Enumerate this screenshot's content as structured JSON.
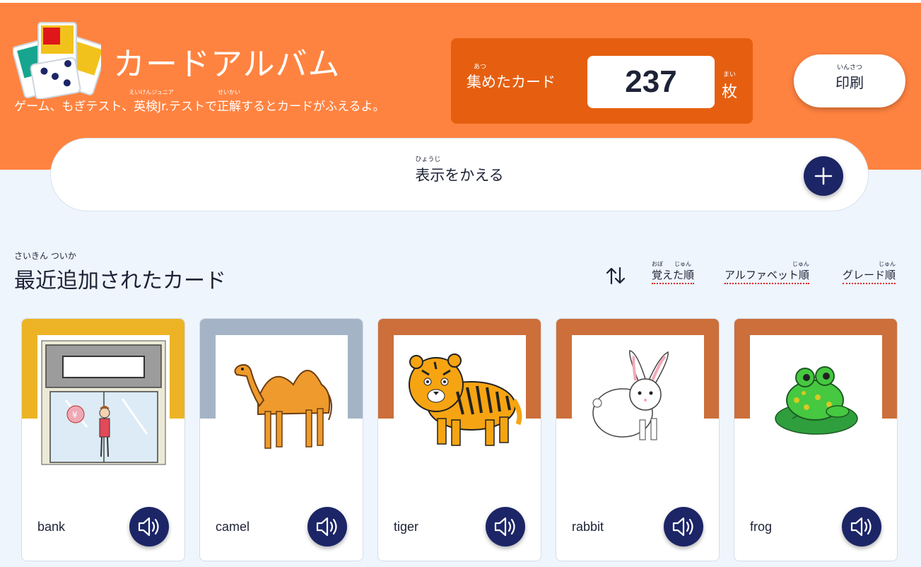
{
  "header": {
    "title": "カードアルバム",
    "subtitle_parts": [
      "ゲーム、もぎテスト、",
      "英検Jr.",
      "テストで",
      "正解",
      "するとカードがふえるよ。"
    ],
    "subtitle_ruby": {
      "eiken": "えいけんジュニア",
      "seikai": "せいかい"
    }
  },
  "counter": {
    "label": "集めたカード",
    "label_ruby": "あつ",
    "value": "237",
    "unit": "枚",
    "unit_ruby": "まい"
  },
  "print": {
    "label": "印刷",
    "ruby": "いんさつ"
  },
  "display_bar": {
    "label": "表示をかえる",
    "ruby": "ひょうじ"
  },
  "section": {
    "title": "最近追加されたカード",
    "ruby": "さいきん ついか"
  },
  "sort": {
    "options": [
      {
        "label": "覚えた順",
        "ruby": "おぼ　　じゅん"
      },
      {
        "label": "アルファベット順",
        "ruby": "じゅん"
      },
      {
        "label": "グレード順",
        "ruby": "じゅん"
      }
    ]
  },
  "cards": [
    {
      "word": "bank",
      "band_color": "#ecb424",
      "image": "bank-icon"
    },
    {
      "word": "camel",
      "band_color": "#a4b4c6",
      "image": "camel-icon"
    },
    {
      "word": "tiger",
      "band_color": "#cc6f3a",
      "image": "tiger-icon"
    },
    {
      "word": "rabbit",
      "band_color": "#cc6f3a",
      "image": "rabbit-icon"
    },
    {
      "word": "frog",
      "band_color": "#cc6f3a",
      "image": "frog-icon"
    }
  ],
  "colors": {
    "header_bg": "#ff8340",
    "counter_bg": "#e65f10",
    "accent_navy": "#1c2566",
    "page_bg": "#eef5fd"
  }
}
